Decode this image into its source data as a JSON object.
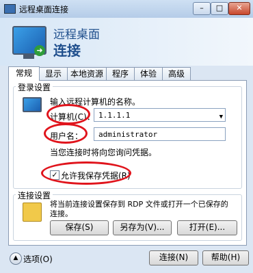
{
  "window": {
    "title": "远程桌面连接",
    "minimize": "–",
    "maximize": "□",
    "close": "✕"
  },
  "header": {
    "line1": "远程桌面",
    "line2": "连接"
  },
  "tabs": [
    "常规",
    "显示",
    "本地资源",
    "程序",
    "体验",
    "高级"
  ],
  "login": {
    "group_title": "登录设置",
    "prompt": "输入远程计算机的名称。",
    "computer_label": "计算机(C)：",
    "computer_value": "1.1.1.1",
    "username_label": "用户名：",
    "username_value": "administrator",
    "note": "当您连接时将向您询问凭据。",
    "save_credentials_label": "允许我保存凭据(R)",
    "save_credentials_checked": "✓"
  },
  "connection": {
    "group_title": "连接设置",
    "description": "将当前连接设置保存到 RDP 文件或打开一个已保存的连接。",
    "save_button": "保存(S)",
    "save_as_button": "另存为(V)...",
    "open_button": "打开(E)..."
  },
  "footer": {
    "options_label": "选项(O)",
    "options_icon": "▲",
    "connect_button": "连接(N)",
    "help_button": "帮助(H)"
  },
  "colors": {
    "annotation": "#e0141c",
    "header_text": "#1e4e8c"
  }
}
